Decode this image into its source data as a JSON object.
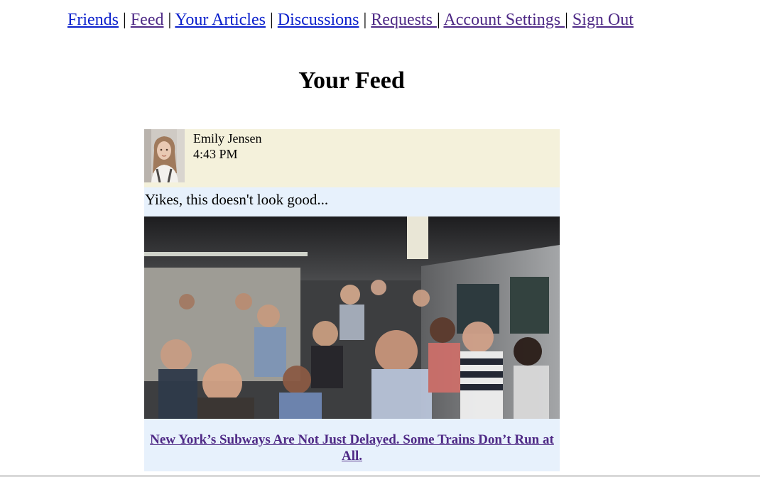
{
  "nav": {
    "items": [
      {
        "label": "Friends"
      },
      {
        "label": "Feed"
      },
      {
        "label": "Your Articles"
      },
      {
        "label": "Discussions"
      },
      {
        "label": "Requests "
      },
      {
        "label": "Account Settings "
      },
      {
        "label": "Sign Out"
      }
    ],
    "separator": "|"
  },
  "page": {
    "title": "Your Feed"
  },
  "post": {
    "author": "Emily Jensen",
    "time": "4:43 PM",
    "text": "Yikes, this doesn't look good...",
    "image_icon": "crowded-subway-photo",
    "article_title": "New York’s Subways Are Not Just Delayed. Some Trains Don’t Run at All."
  },
  "colors": {
    "link_unvisited": "#0a1fcc",
    "link_visited": "#4f2a86",
    "post_header_bg": "#f4f1db",
    "post_body_bg": "#e7f1fc"
  }
}
